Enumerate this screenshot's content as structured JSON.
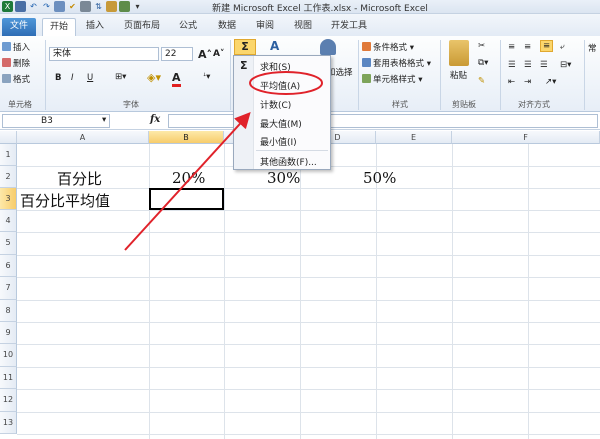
{
  "window": {
    "title": "新建 Microsoft Excel 工作表.xlsx - Microsoft Excel"
  },
  "tabs": [
    "文件",
    "开始",
    "插入",
    "页面布局",
    "公式",
    "数据",
    "审阅",
    "视图",
    "开发工具"
  ],
  "ribbon": {
    "cells_group": {
      "insert": "插入",
      "delete": "删除",
      "format": "格式",
      "label": "单元格"
    },
    "font_group": {
      "font_name": "宋体",
      "font_size": "22",
      "bold": "B",
      "italic": "I",
      "underline": "U",
      "grow": "A",
      "shrink": "A",
      "label": "字体"
    },
    "styles_group": {
      "conditional": "条件格式",
      "table": "套用表格格式",
      "cell_styles": "单元格样式",
      "label": "样式"
    },
    "clipboard_group": {
      "paste": "粘贴",
      "label": "剪贴板"
    },
    "alignment_group": {
      "label": "对齐方式"
    },
    "find_select": "查找和选择",
    "sigma": "Σ",
    "sort_label": "A",
    "extra": "常"
  },
  "formula_bar": {
    "name_box": "B3",
    "fx": "fx",
    "value": ""
  },
  "columns": [
    "A",
    "B",
    "C",
    "D",
    "E",
    "F"
  ],
  "rows": [
    "1",
    "2",
    "3",
    "4",
    "5",
    "6",
    "7",
    "8",
    "9",
    "10",
    "11",
    "12",
    "13"
  ],
  "cells": {
    "A2": "百分比",
    "B2": "20%",
    "C2": "30%",
    "D2": "50%",
    "A3": "百分比平均值"
  },
  "autosum_menu": {
    "items": [
      "求和(S)",
      "平均值(A)",
      "计数(C)",
      "最大值(M)",
      "最小值(I)",
      "其他函数(F)..."
    ],
    "highlighted": "平均值(A)"
  },
  "annotation_color": "#e0222a"
}
